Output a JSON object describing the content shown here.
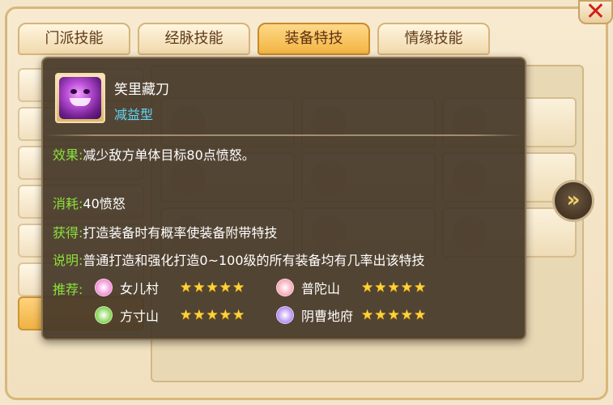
{
  "tabs": [
    {
      "label": "门派技能",
      "active": false
    },
    {
      "label": "经脉技能",
      "active": false
    },
    {
      "label": "装备特技",
      "active": true
    },
    {
      "label": "情缘技能",
      "active": false
    }
  ],
  "close_label": "✕",
  "next_arrow_label": "»",
  "tooltip": {
    "name": "笑里藏刀",
    "type": "减益型",
    "effect_label": "效果:",
    "effect_text": "减少敌方单体目标80点愤怒。",
    "cost_label": "消耗:",
    "cost_text": "40愤怒",
    "obtain_label": "获得:",
    "obtain_text": "打造装备时有概率使装备附带特技",
    "note_label": "说明:",
    "note_text": "普通打造和强化打造0~100级的所有装备均有几率出该特技",
    "recommend_label": "推荐:",
    "recommend": [
      {
        "name": "女儿村",
        "stars": 5,
        "icon": "women-village-icon",
        "color": "#f28bd5"
      },
      {
        "name": "普陀山",
        "stars": 5,
        "icon": "putuo-mountain-icon",
        "color": "#f7a4b4"
      },
      {
        "name": "方寸山",
        "stars": 5,
        "icon": "fangcun-mountain-icon",
        "color": "#7fd24a"
      },
      {
        "name": "阴曹地府",
        "stars": 5,
        "icon": "underworld-icon",
        "color": "#b18bf0"
      }
    ]
  },
  "colors": {
    "label_green": "#8be13a",
    "type_cyan": "#5fd8f6",
    "active_tab": "#f2b441",
    "star": "#ffd23a"
  }
}
